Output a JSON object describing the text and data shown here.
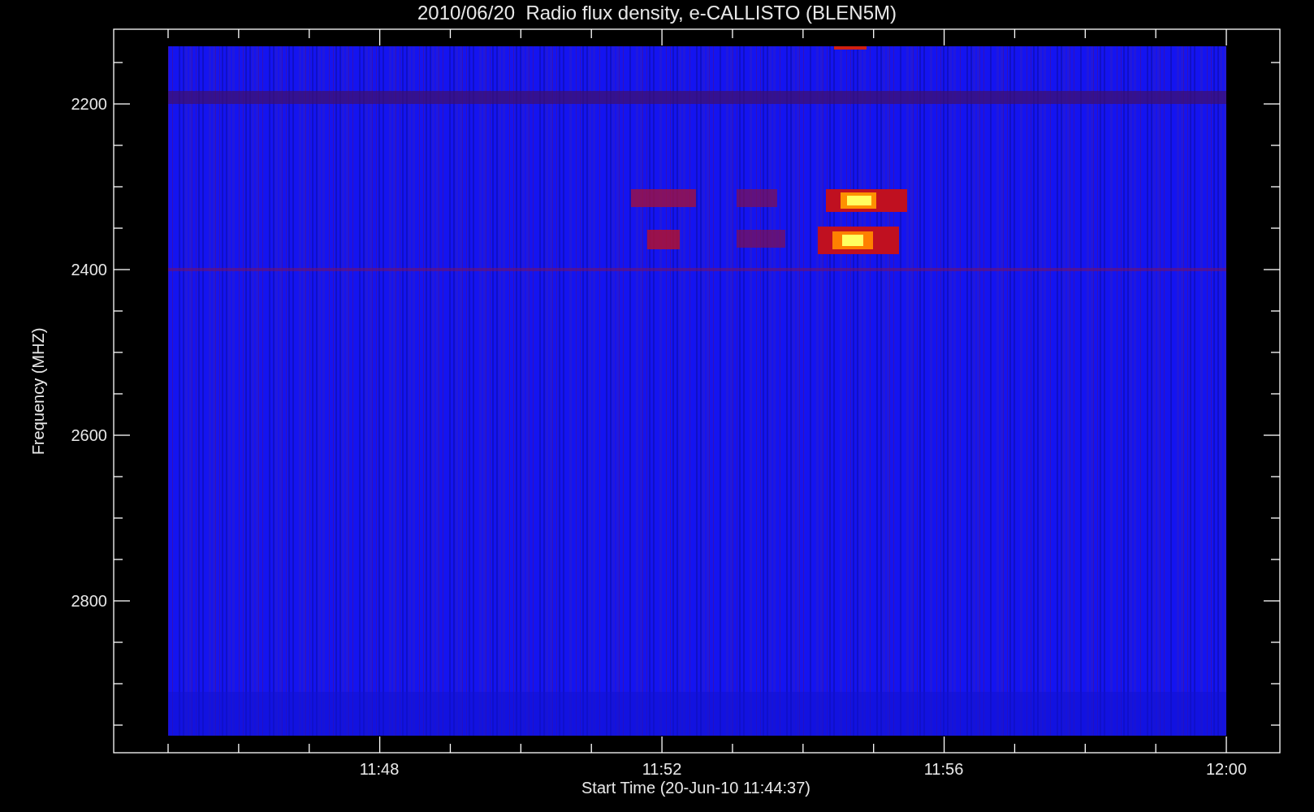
{
  "title": "2010/06/20  Radio flux density, e-CALLISTO (BLEN5M)",
  "y_axis": {
    "label": "Frequency (MHZ)",
    "ticks": [
      "2200",
      "2400",
      "2600",
      "2800"
    ]
  },
  "x_axis": {
    "label": "Start Time (20-Jun-10 11:44:37)",
    "ticks": [
      "11:48",
      "11:52",
      "11:56",
      "12:00"
    ]
  }
}
